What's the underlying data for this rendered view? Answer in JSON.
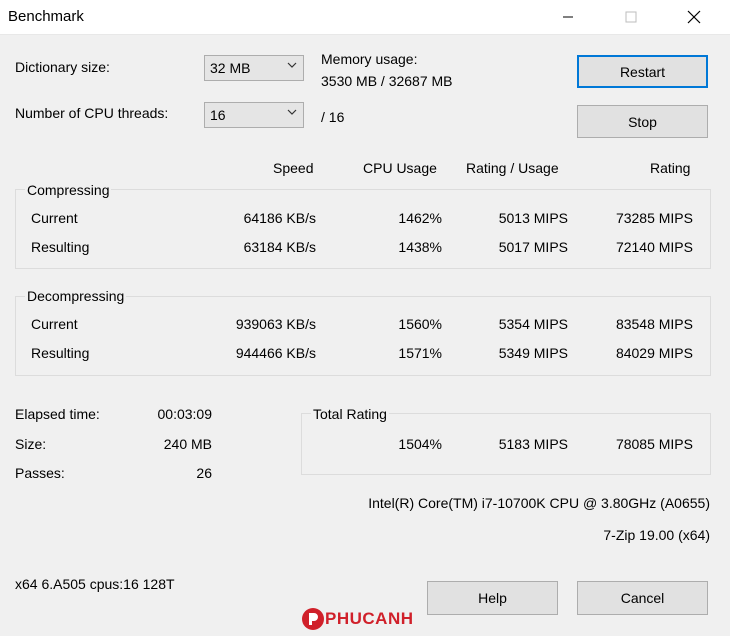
{
  "window": {
    "title": "Benchmark"
  },
  "controls": {
    "dict_label": "Dictionary size:",
    "dict_value": "32 MB",
    "threads_label": "Number of CPU threads:",
    "threads_value": "16",
    "threads_max": "/ 16",
    "mem_label": "Memory usage:",
    "mem_value": "3530 MB / 32687 MB",
    "restart": "Restart",
    "stop": "Stop"
  },
  "columns": {
    "speed": "Speed",
    "cpu": "CPU Usage",
    "rating_usage": "Rating / Usage",
    "rating": "Rating"
  },
  "compressing": {
    "label": "Compressing",
    "current": {
      "label": "Current",
      "speed": "64186 KB/s",
      "cpu": "1462%",
      "rating_usage": "5013 MIPS",
      "rating": "73285 MIPS"
    },
    "resulting": {
      "label": "Resulting",
      "speed": "63184 KB/s",
      "cpu": "1438%",
      "rating_usage": "5017 MIPS",
      "rating": "72140 MIPS"
    }
  },
  "decompressing": {
    "label": "Decompressing",
    "current": {
      "label": "Current",
      "speed": "939063 KB/s",
      "cpu": "1560%",
      "rating_usage": "5354 MIPS",
      "rating": "83548 MIPS"
    },
    "resulting": {
      "label": "Resulting",
      "speed": "944466 KB/s",
      "cpu": "1571%",
      "rating_usage": "5349 MIPS",
      "rating": "84029 MIPS"
    }
  },
  "stats": {
    "elapsed_label": "Elapsed time:",
    "elapsed": "00:03:09",
    "size_label": "Size:",
    "size": "240 MB",
    "passes_label": "Passes:",
    "passes": "26"
  },
  "total": {
    "label": "Total Rating",
    "cpu": "1504%",
    "rating_usage": "5183 MIPS",
    "rating": "78085 MIPS"
  },
  "system": {
    "cpu_name": "Intel(R) Core(TM) i7-10700K CPU @ 3.80GHz (A0655)",
    "version": "7-Zip 19.00 (x64)",
    "arch": "x64 6.A505 cpus:16 128T"
  },
  "footer": {
    "help": "Help",
    "cancel": "Cancel"
  },
  "watermark": {
    "text": "PHUCANH"
  },
  "colors": {
    "accent": "#0078d7",
    "watermark": "#d0202a"
  }
}
